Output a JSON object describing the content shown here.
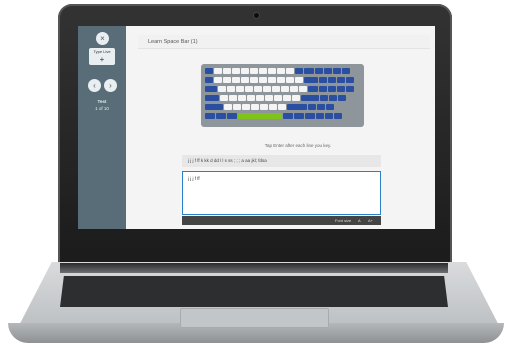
{
  "sidebar": {
    "top_btn": "×",
    "box_label": "Type Live",
    "box_plus": "+",
    "prev": "‹",
    "next": "›",
    "test_label": "Test",
    "test_count": "1 of 10"
  },
  "header": {
    "title": "Learn Space Bar (1)"
  },
  "hint": "Tap Enter after each line you key.",
  "prompt": "j j j f ff k kk d dd l l s ss ; ; ; a aa jkl; fdsa",
  "input": {
    "value": "j j j f ff"
  },
  "bar": {
    "label": "Font size",
    "a": "A",
    "b": "A+"
  },
  "colors": {
    "accent": "#2a4fa0",
    "highlight": "#7fc31a",
    "sidebar": "#596d78"
  }
}
